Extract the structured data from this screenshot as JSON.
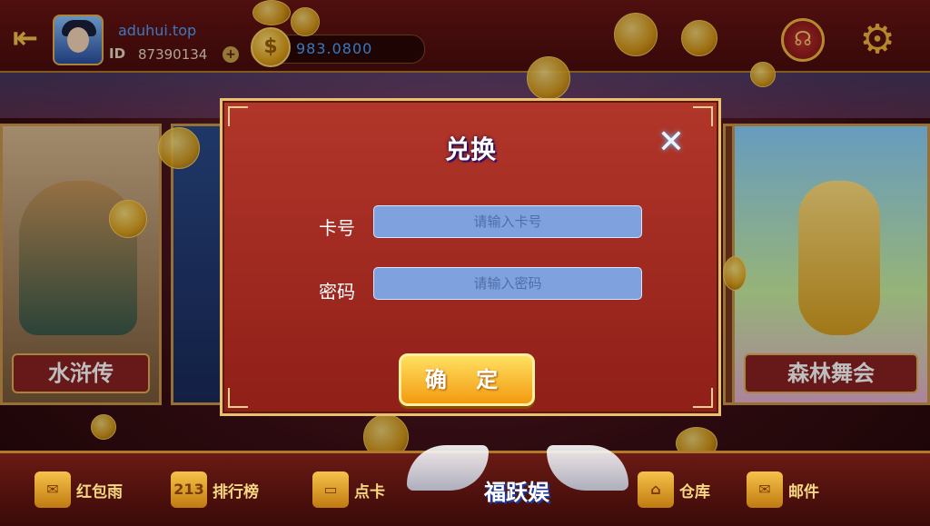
{
  "header": {
    "username": "aduhui.top",
    "id_label": "ID",
    "user_id": "87390134",
    "balance": "983.0800",
    "icons": [
      "back-icon",
      "avatar",
      "plus-icon",
      "coin-icon",
      "customer-service-icon",
      "gear-icon"
    ]
  },
  "games": {
    "left_label": "水浒传",
    "right_label": "森林舞会"
  },
  "dialog": {
    "title": "兑换",
    "card_label": "卡号",
    "card_placeholder": "请输入卡号",
    "password_label": "密码",
    "password_placeholder": "请输入密码",
    "confirm_label": "确 定",
    "close_icon": "close-icon"
  },
  "bottom_nav": {
    "items": [
      {
        "label": "红包雨",
        "icon": "red-envelope-icon"
      },
      {
        "label": "排行榜",
        "icon": "leaderboard-icon"
      },
      {
        "label": "点卡",
        "icon": "card-icon"
      },
      {
        "label": "仓库",
        "icon": "warehouse-icon"
      },
      {
        "label": "邮件",
        "icon": "mail-icon"
      }
    ],
    "center_logo": "福跃娱"
  },
  "colors": {
    "accent_gold": "#f3c24a",
    "dialog_red": "#b2362a",
    "input_blue": "#7fa2de",
    "link_blue": "#4fa0ff"
  }
}
